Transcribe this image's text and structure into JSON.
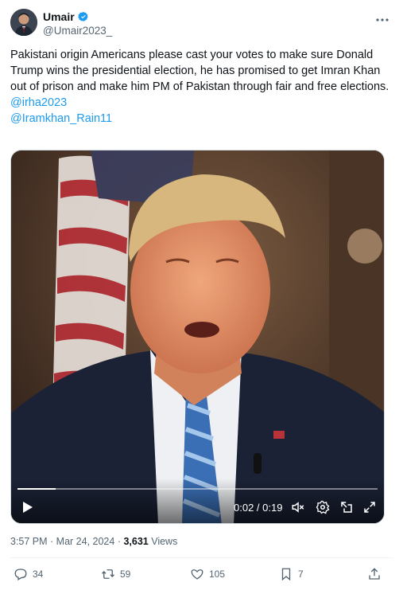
{
  "author": {
    "display_name": "Umair",
    "handle": "@Umair2023_",
    "verified_icon": "verified-badge-icon",
    "accent_color": "#1d9bf0"
  },
  "tweet": {
    "text": "Pakistani origin Americans please cast your votes to make sure Donald Trump wins the presidential election, he has promised to get Imran Khan out of prison and make him PM of Pakistan through fair and free elections.",
    "mentions": [
      "@irha2023",
      "@Iramkhan_Rain11"
    ]
  },
  "video": {
    "current_time": "0:02",
    "duration": "0:19",
    "time_display": "0:02 / 0:19",
    "progress_fraction": 0.105
  },
  "meta": {
    "time": "3:57 PM",
    "separator": " · ",
    "date": "Mar 24, 2024",
    "views_count": "3,631",
    "views_label": " Views"
  },
  "actions": {
    "replies": "34",
    "reposts": "59",
    "likes": "105",
    "bookmarks": "7"
  }
}
